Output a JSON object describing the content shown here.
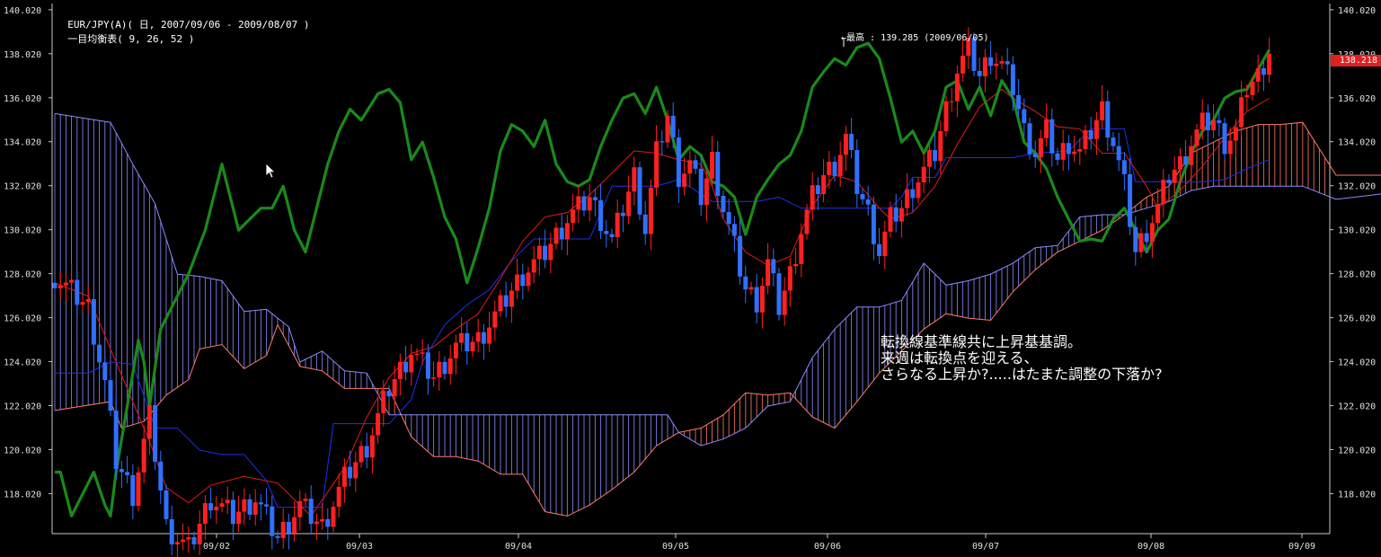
{
  "header": {
    "symbol": "EUR/JPY(A)( 日, 2007/09/06 - 2009/08/07 )",
    "indicator": "一目均衡表( 9, 26, 52 )"
  },
  "max_label": "←最高 : 139.285 (2009/06/05)",
  "current_price": "138.218",
  "note": {
    "line1": "転換線基準線共に上昇基基調。",
    "line2": "来週は転換点を迎える、",
    "line3": "さらなる上昇か?.....はたまた調整の下落か?"
  },
  "colors": {
    "background": "#000000",
    "up_candle": "#ff2020",
    "down_candle": "#3070ff",
    "tenkan": "#d01818",
    "kijun": "#1c2cd8",
    "chikou": "#1a8a1a",
    "cloud_bull": "#ff7a6a",
    "cloud_bear": "#8a8cff"
  },
  "chart_data": {
    "type": "candlestick",
    "ylim": [
      116.2,
      140.3
    ],
    "yticks": [
      "140.020",
      "138.020",
      "136.020",
      "134.020",
      "132.020",
      "130.020",
      "128.020",
      "126.020",
      "124.020",
      "122.020",
      "120.020",
      "118.020"
    ],
    "xticks": [
      "09/02",
      "09/03",
      "09/04",
      "09/05",
      "09/06",
      "09/07",
      "09/08",
      "09/09"
    ],
    "close_pts": [
      [
        0,
        127.9
      ],
      [
        6,
        126.5
      ],
      [
        9,
        123
      ],
      [
        11,
        119.5
      ],
      [
        14,
        118
      ],
      [
        17,
        121.5
      ],
      [
        20,
        116.5
      ],
      [
        24,
        115.5
      ],
      [
        28,
        117.8
      ],
      [
        32,
        117
      ],
      [
        36,
        117.8
      ],
      [
        40,
        116
      ],
      [
        44,
        117.5
      ],
      [
        48,
        116.5
      ],
      [
        52,
        118.7
      ],
      [
        56,
        120.2
      ],
      [
        60,
        122.8
      ],
      [
        64,
        124.5
      ],
      [
        68,
        123.3
      ],
      [
        72,
        124.7
      ],
      [
        76,
        125
      ],
      [
        80,
        126.5
      ],
      [
        84,
        128
      ],
      [
        88,
        129
      ],
      [
        92,
        130.5
      ],
      [
        96,
        131.5
      ],
      [
        100,
        129.5
      ],
      [
        104,
        132.5
      ],
      [
        106,
        130
      ],
      [
        108,
        133.5
      ],
      [
        110,
        135.2
      ],
      [
        112,
        132.5
      ],
      [
        114,
        133
      ],
      [
        116,
        131.5
      ],
      [
        118,
        133.2
      ],
      [
        120,
        131
      ],
      [
        122,
        129.2
      ],
      [
        124,
        127.3
      ],
      [
        126,
        126.8
      ],
      [
        128,
        128.5
      ],
      [
        130,
        126.5
      ],
      [
        132,
        128
      ],
      [
        134,
        130
      ],
      [
        136,
        131.5
      ],
      [
        138,
        132.5
      ],
      [
        140,
        133
      ],
      [
        142,
        134.2
      ],
      [
        144,
        132
      ],
      [
        146,
        130.8
      ],
      [
        148,
        129
      ],
      [
        150,
        130.5
      ],
      [
        152,
        131
      ],
      [
        154,
        132
      ],
      [
        156,
        132.7
      ],
      [
        158,
        133.5
      ],
      [
        160,
        135.5
      ],
      [
        162,
        137.3
      ],
      [
        164,
        138.2
      ],
      [
        166,
        137
      ],
      [
        168,
        138
      ],
      [
        170,
        137.5
      ],
      [
        172,
        136.5
      ],
      [
        174,
        134.5
      ],
      [
        176,
        133.5
      ],
      [
        178,
        134.5
      ],
      [
        180,
        133.2
      ],
      [
        182,
        134
      ],
      [
        184,
        133.5
      ],
      [
        186,
        134.5
      ],
      [
        188,
        135.5
      ],
      [
        190,
        134
      ],
      [
        192,
        132
      ],
      [
        194,
        129
      ],
      [
        196,
        130
      ],
      [
        198,
        131
      ],
      [
        200,
        132.5
      ],
      [
        202,
        133
      ],
      [
        204,
        134
      ],
      [
        206,
        134.8
      ],
      [
        208,
        135
      ],
      [
        210,
        134
      ],
      [
        212,
        134.5
      ],
      [
        214,
        136.5
      ],
      [
        216,
        137
      ],
      [
        218,
        138.2
      ]
    ],
    "tenkan": [
      [
        0,
        127.6
      ],
      [
        6,
        127
      ],
      [
        10,
        124.6
      ],
      [
        14,
        122.2
      ],
      [
        17,
        120.4
      ],
      [
        20,
        118.3
      ],
      [
        24,
        117.6
      ],
      [
        28,
        118.4
      ],
      [
        34,
        118.8
      ],
      [
        40,
        118.5
      ],
      [
        46,
        117
      ],
      [
        52,
        119.2
      ],
      [
        56,
        121.5
      ],
      [
        60,
        123.3
      ],
      [
        64,
        124.4
      ],
      [
        68,
        124.7
      ],
      [
        72,
        125.5
      ],
      [
        76,
        126.2
      ],
      [
        80,
        127.8
      ],
      [
        84,
        129.5
      ],
      [
        88,
        130.6
      ],
      [
        92,
        130.8
      ],
      [
        96,
        131.6
      ],
      [
        100,
        132.6
      ],
      [
        104,
        133.6
      ],
      [
        108,
        133.5
      ],
      [
        112,
        133.2
      ],
      [
        116,
        133
      ],
      [
        118,
        132
      ],
      [
        120,
        130.5
      ],
      [
        124,
        129
      ],
      [
        128,
        128.4
      ],
      [
        132,
        128.8
      ],
      [
        136,
        131.1
      ],
      [
        140,
        132.5
      ],
      [
        144,
        132.2
      ],
      [
        148,
        131
      ],
      [
        150,
        130.5
      ],
      [
        154,
        130.8
      ],
      [
        158,
        132
      ],
      [
        162,
        133.9
      ],
      [
        166,
        135.6
      ],
      [
        170,
        136.4
      ],
      [
        172,
        136
      ],
      [
        176,
        135.4
      ],
      [
        180,
        134.7
      ],
      [
        184,
        134.6
      ],
      [
        188,
        133.5
      ],
      [
        192,
        133.5
      ],
      [
        196,
        132
      ],
      [
        198,
        131
      ],
      [
        202,
        131.8
      ],
      [
        206,
        132.9
      ],
      [
        210,
        134.2
      ],
      [
        214,
        135.4
      ],
      [
        218,
        136
      ]
    ],
    "kijun": [
      [
        0,
        123.5
      ],
      [
        6,
        123.5
      ],
      [
        10,
        124
      ],
      [
        14,
        123.9
      ],
      [
        18,
        121
      ],
      [
        22,
        121
      ],
      [
        26,
        120
      ],
      [
        30,
        119.8
      ],
      [
        34,
        119.8
      ],
      [
        38,
        118.6
      ],
      [
        40,
        117.4
      ],
      [
        44,
        117.4
      ],
      [
        48,
        117.4
      ],
      [
        50,
        121.2
      ],
      [
        60,
        121.2
      ],
      [
        64,
        122.3
      ],
      [
        66,
        124
      ],
      [
        70,
        125.7
      ],
      [
        74,
        126.6
      ],
      [
        78,
        127.3
      ],
      [
        82,
        128.6
      ],
      [
        86,
        129.6
      ],
      [
        90,
        129.6
      ],
      [
        96,
        129.6
      ],
      [
        100,
        132
      ],
      [
        108,
        132
      ],
      [
        112,
        132.3
      ],
      [
        118,
        131.3
      ],
      [
        126,
        131.3
      ],
      [
        130,
        131.5
      ],
      [
        134,
        131
      ],
      [
        140,
        131
      ],
      [
        150,
        131
      ],
      [
        152,
        131.5
      ],
      [
        154,
        132.4
      ],
      [
        158,
        132.4
      ],
      [
        160,
        133.3
      ],
      [
        166,
        133.3
      ],
      [
        172,
        133.3
      ],
      [
        176,
        133.5
      ],
      [
        182,
        133.6
      ],
      [
        186,
        134.6
      ],
      [
        188,
        134.6
      ],
      [
        192,
        134.6
      ],
      [
        194,
        132.2
      ],
      [
        198,
        132.2
      ],
      [
        206,
        132.2
      ],
      [
        210,
        132.3
      ],
      [
        214,
        132.8
      ],
      [
        218,
        133.2
      ]
    ],
    "chikou": [
      [
        0,
        119
      ],
      [
        1,
        119
      ],
      [
        3,
        117
      ],
      [
        5,
        118
      ],
      [
        7,
        119
      ],
      [
        9,
        117.5
      ],
      [
        10,
        117
      ],
      [
        11,
        119
      ],
      [
        13,
        122
      ],
      [
        15,
        125
      ],
      [
        16,
        124
      ],
      [
        17,
        122
      ],
      [
        19,
        125.5
      ],
      [
        21,
        126.5
      ],
      [
        24,
        128
      ],
      [
        27,
        130
      ],
      [
        30,
        133
      ],
      [
        33,
        130
      ],
      [
        35,
        130.5
      ],
      [
        37,
        131
      ],
      [
        39,
        131
      ],
      [
        41,
        132
      ],
      [
        43,
        130
      ],
      [
        45,
        129
      ],
      [
        47,
        131
      ],
      [
        49,
        133
      ],
      [
        51,
        134.5
      ],
      [
        53,
        135.5
      ],
      [
        55,
        135
      ],
      [
        58,
        136.2
      ],
      [
        60,
        136.4
      ],
      [
        62,
        135.8
      ],
      [
        64,
        133.2
      ],
      [
        66,
        134
      ],
      [
        68,
        132.4
      ],
      [
        70,
        130.6
      ],
      [
        72,
        129.6
      ],
      [
        74,
        127.6
      ],
      [
        76,
        129.2
      ],
      [
        78,
        131
      ],
      [
        80,
        133.6
      ],
      [
        82,
        134.8
      ],
      [
        84,
        134.5
      ],
      [
        86,
        133.8
      ],
      [
        88,
        135
      ],
      [
        90,
        133
      ],
      [
        92,
        132.2
      ],
      [
        94,
        132
      ],
      [
        96,
        132.3
      ],
      [
        98,
        133.8
      ],
      [
        100,
        135
      ],
      [
        102,
        136
      ],
      [
        104,
        136.2
      ],
      [
        106,
        135.3
      ],
      [
        108,
        136.5
      ],
      [
        110,
        135
      ],
      [
        112,
        133.2
      ],
      [
        114,
        133.8
      ],
      [
        116,
        133.4
      ],
      [
        118,
        132.2
      ],
      [
        120,
        132
      ],
      [
        122,
        131.5
      ],
      [
        124,
        129.8
      ],
      [
        126,
        131.5
      ],
      [
        128,
        132.3
      ],
      [
        130,
        133
      ],
      [
        132,
        133.4
      ],
      [
        134,
        134.5
      ],
      [
        136,
        136.5
      ],
      [
        138,
        137.2
      ],
      [
        140,
        137.8
      ],
      [
        142,
        137.5
      ],
      [
        144,
        138.3
      ],
      [
        146,
        138.5
      ],
      [
        148,
        137.8
      ],
      [
        150,
        136
      ],
      [
        152,
        134
      ],
      [
        154,
        134.5
      ],
      [
        156,
        133.5
      ],
      [
        158,
        134.5
      ],
      [
        160,
        136.5
      ],
      [
        162,
        136.8
      ],
      [
        164,
        135.5
      ],
      [
        166,
        136.5
      ],
      [
        168,
        135.2
      ],
      [
        170,
        136.8
      ],
      [
        172,
        136
      ],
      [
        174,
        134
      ],
      [
        176,
        133.5
      ],
      [
        178,
        132.8
      ],
      [
        180,
        131.5
      ],
      [
        182,
        130.5
      ],
      [
        184,
        129.5
      ],
      [
        186,
        129.6
      ],
      [
        188,
        129.5
      ],
      [
        190,
        130.5
      ],
      [
        192,
        131
      ],
      [
        194,
        130
      ],
      [
        196,
        129
      ],
      [
        198,
        130
      ],
      [
        200,
        130.5
      ],
      [
        202,
        132.2
      ],
      [
        204,
        133.5
      ],
      [
        206,
        134.5
      ],
      [
        208,
        135
      ],
      [
        210,
        136
      ],
      [
        212,
        136.3
      ],
      [
        214,
        136.4
      ],
      [
        216,
        137.3
      ],
      [
        218,
        138.2
      ]
    ],
    "span_a": [
      [
        0,
        121.8
      ],
      [
        10,
        122.2
      ],
      [
        12,
        121
      ],
      [
        16,
        121.3
      ],
      [
        20,
        122.5
      ],
      [
        24,
        123.2
      ],
      [
        26,
        124.6
      ],
      [
        30,
        124.8
      ],
      [
        34,
        123.7
      ],
      [
        38,
        124.3
      ],
      [
        40,
        125.7
      ],
      [
        44,
        123.8
      ],
      [
        48,
        123.6
      ],
      [
        52,
        122.8
      ],
      [
        60,
        122.8
      ],
      [
        64,
        120.6
      ],
      [
        68,
        119.7
      ],
      [
        72,
        119.7
      ],
      [
        76,
        119.5
      ],
      [
        80,
        118.9
      ],
      [
        84,
        118.9
      ],
      [
        88,
        117.2
      ],
      [
        92,
        117
      ],
      [
        96,
        117.5
      ],
      [
        100,
        118.2
      ],
      [
        104,
        119
      ],
      [
        108,
        120.2
      ],
      [
        112,
        120.8
      ],
      [
        116,
        121
      ],
      [
        120,
        121.6
      ],
      [
        124,
        122.6
      ],
      [
        128,
        122.5
      ],
      [
        132,
        122.6
      ],
      [
        136,
        121.5
      ],
      [
        140,
        121
      ],
      [
        144,
        122.2
      ],
      [
        148,
        123.5
      ],
      [
        152,
        124.5
      ],
      [
        156,
        125.5
      ],
      [
        160,
        126.2
      ],
      [
        164,
        126
      ],
      [
        168,
        125.9
      ],
      [
        172,
        127.2
      ],
      [
        176,
        128.2
      ],
      [
        180,
        129
      ],
      [
        184,
        129.5
      ],
      [
        188,
        130
      ],
      [
        192,
        130.7
      ],
      [
        196,
        131.5
      ],
      [
        200,
        132
      ],
      [
        204,
        133.5
      ],
      [
        208,
        134
      ],
      [
        212,
        134.5
      ],
      [
        216,
        134.8
      ],
      [
        220,
        134.8
      ],
      [
        224,
        134.9
      ],
      [
        230,
        132.5
      ],
      [
        240,
        132.5
      ],
      [
        250,
        133
      ],
      [
        260,
        133.5
      ],
      [
        270,
        133.2
      ],
      [
        280,
        133.5
      ]
    ],
    "span_b": [
      [
        0,
        135.3
      ],
      [
        10,
        134.9
      ],
      [
        14,
        133
      ],
      [
        18,
        131.2
      ],
      [
        22,
        128
      ],
      [
        26,
        127.9
      ],
      [
        30,
        127.7
      ],
      [
        34,
        126.3
      ],
      [
        38,
        126.4
      ],
      [
        42,
        125.6
      ],
      [
        44,
        124
      ],
      [
        48,
        124.5
      ],
      [
        52,
        123.6
      ],
      [
        56,
        123.5
      ],
      [
        60,
        121.6
      ],
      [
        64,
        121.6
      ],
      [
        68,
        121.6
      ],
      [
        72,
        121.6
      ],
      [
        76,
        121.6
      ],
      [
        80,
        121.6
      ],
      [
        84,
        121.6
      ],
      [
        88,
        121.6
      ],
      [
        92,
        121.6
      ],
      [
        96,
        121.6
      ],
      [
        100,
        121.6
      ],
      [
        104,
        121.6
      ],
      [
        108,
        121.6
      ],
      [
        110,
        121.6
      ],
      [
        112,
        120.8
      ],
      [
        116,
        120.2
      ],
      [
        120,
        120.5
      ],
      [
        124,
        121
      ],
      [
        128,
        122
      ],
      [
        132,
        122.2
      ],
      [
        136,
        124.2
      ],
      [
        140,
        125.5
      ],
      [
        144,
        126.5
      ],
      [
        148,
        126.5
      ],
      [
        152,
        126.8
      ],
      [
        156,
        128.5
      ],
      [
        160,
        127.5
      ],
      [
        164,
        127.7
      ],
      [
        168,
        128
      ],
      [
        172,
        128.5
      ],
      [
        176,
        129.2
      ],
      [
        180,
        129.3
      ],
      [
        184,
        130.6
      ],
      [
        188,
        130.7
      ],
      [
        192,
        130.7
      ],
      [
        196,
        131
      ],
      [
        200,
        131.3
      ],
      [
        204,
        131.8
      ],
      [
        208,
        132
      ],
      [
        212,
        132
      ],
      [
        216,
        132
      ],
      [
        220,
        132
      ],
      [
        224,
        132
      ],
      [
        230,
        131.4
      ],
      [
        240,
        131.7
      ],
      [
        250,
        132
      ],
      [
        260,
        133.2
      ],
      [
        270,
        133.2
      ],
      [
        280,
        133.2
      ]
    ]
  }
}
